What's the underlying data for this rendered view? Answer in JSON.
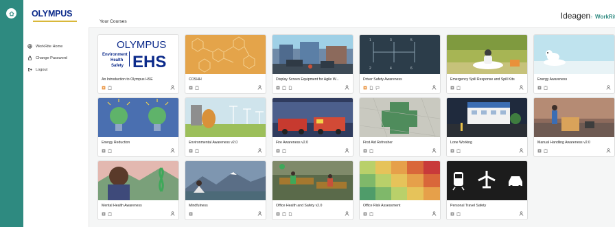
{
  "app": {
    "logo_text": "OLYMPUS",
    "brand": "Ideagen",
    "brand_product": "WorkRite"
  },
  "sidebar": {
    "items": [
      {
        "label": "WorkRite Home",
        "icon": "globe-icon"
      },
      {
        "label": "Change Password",
        "icon": "lock-icon"
      },
      {
        "label": "Logout",
        "icon": "logout-icon"
      }
    ]
  },
  "page": {
    "title": "Your Courses"
  },
  "colors": {
    "rail": "#2e8a80",
    "accent_orange": "#e9913a",
    "icon_gray": "#8a8a8a"
  },
  "courses": [
    {
      "title": "An Introduction to Olympus HSE",
      "thumb_text_1": "OLYMPUS",
      "thumb_text_2": "Environment",
      "thumb_text_3": "Health",
      "thumb_text_4": "Safety",
      "thumb_text_5": "EHS",
      "orange": true,
      "third": false
    },
    {
      "title": "COSHH",
      "orange": false,
      "third": false
    },
    {
      "title": "Display Screen Equipment for Agile W...",
      "orange": false,
      "third": true
    },
    {
      "title": "Driver Safety Awareness",
      "orange": true,
      "third": true
    },
    {
      "title": "Emergency Spill Response and Spill Kits",
      "orange": false,
      "third": false
    },
    {
      "title": "Energy Awareness",
      "orange": false,
      "third": false
    },
    {
      "title": "Energy Reduction",
      "orange": false,
      "third": false
    },
    {
      "title": "Environmental Awareness v2.0",
      "orange": false,
      "third": false
    },
    {
      "title": "Fire Awareness v2.0",
      "orange": false,
      "third": false
    },
    {
      "title": "First Aid Refresher",
      "orange": false,
      "third": false
    },
    {
      "title": "Lone Working",
      "orange": false,
      "third": false
    },
    {
      "title": "Manual Handling Awareness v2.0",
      "orange": false,
      "third": false
    },
    {
      "title": "Mental Health Awareness",
      "orange": false,
      "third": false
    },
    {
      "title": "Mindfulness",
      "orange": false,
      "third": false
    },
    {
      "title": "Office Health and Safety v2.0",
      "orange": false,
      "third": true
    },
    {
      "title": "Office Risk Assessment",
      "orange": false,
      "third": false
    },
    {
      "title": "Personal Travel Safety",
      "orange": false,
      "third": false
    }
  ]
}
